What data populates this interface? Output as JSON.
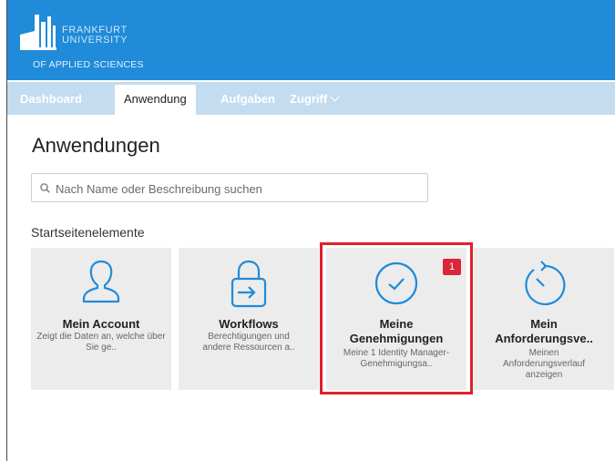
{
  "logo": {
    "line1": "FRANKFURT",
    "line2": "UNIVERSITY",
    "line3": "OF APPLIED SCIENCES"
  },
  "nav": {
    "tabs": [
      {
        "label": "Dashboard",
        "active": false
      },
      {
        "label": "Anwendung",
        "active": true
      },
      {
        "label": "Aufgaben",
        "active": false
      },
      {
        "label": "Zugriff",
        "active": false,
        "dropdown": true
      }
    ]
  },
  "main": {
    "title": "Anwendungen",
    "search": {
      "placeholder": "Nach Name oder Beschreibung suchen",
      "value": ""
    },
    "section_label": "Startseitenelemente",
    "tiles": [
      {
        "title": "Mein Account",
        "description": "Zeigt die Daten an, welche über Sie ge..",
        "icon": "user-icon"
      },
      {
        "title": "Workflows",
        "description": "Berechtigungen und andere Ressourcen a..",
        "icon": "lock-arrow-icon"
      },
      {
        "title_line1": "Meine",
        "title_line2": "Genehmigungen",
        "description_line1": "Meine 1 Identity Manager-",
        "description_line2": "Genehmigungsa..",
        "icon": "check-circle-icon",
        "badge": "1",
        "highlighted": true
      },
      {
        "title_line1": "Mein",
        "title_line2": "Anforderungsve..",
        "description_line1": "Meinen",
        "description_line2": "Anforderungsverlauf",
        "description_line3": "anzeigen",
        "icon": "history-icon"
      }
    ]
  },
  "colors": {
    "header": "#1f8bd9",
    "nav_bar": "#c4dcef",
    "tile_bg": "#ececec",
    "icon_blue": "#1f8bd9",
    "highlight": "#e0202b",
    "badge": "#d9263a"
  }
}
